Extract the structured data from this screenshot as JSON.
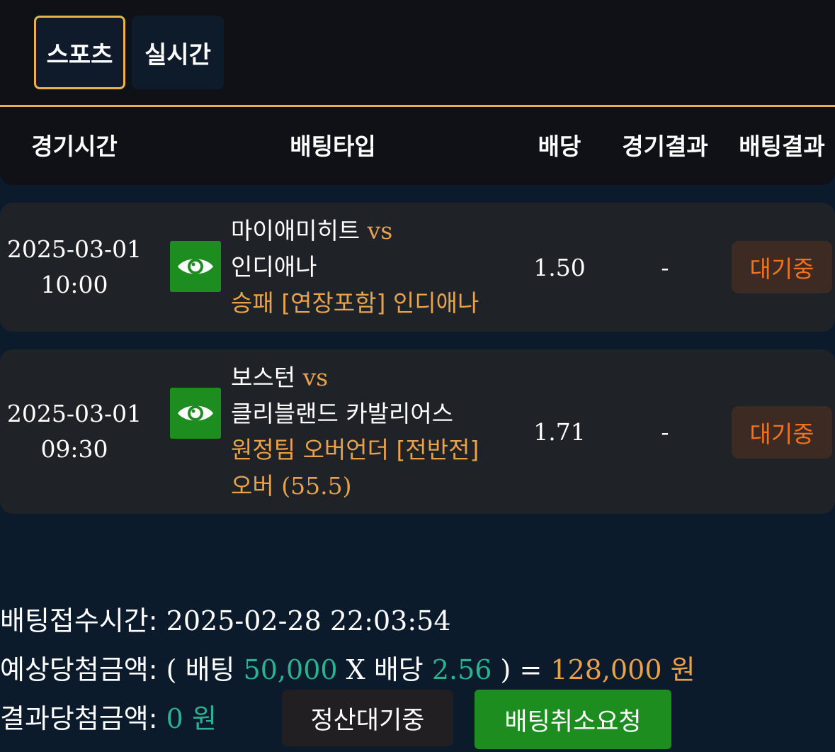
{
  "tabs": [
    {
      "label": "스포츠",
      "active": true
    },
    {
      "label": "실시간",
      "active": false
    }
  ],
  "columns": {
    "time": "경기시간",
    "bet_type": "배팅타입",
    "odds": "배당",
    "game_result": "경기결과",
    "bet_result": "배팅결과"
  },
  "rows": [
    {
      "date": "2025-03-01",
      "time": "10:00",
      "home": "마이애미히트",
      "vs": "vs",
      "away": "인디애나",
      "pick": "승패 [연장포함] 인디애나",
      "pick_line2": "",
      "odds": "1.50",
      "game_result": "-",
      "status": "대기중"
    },
    {
      "date": "2025-03-01",
      "time": "09:30",
      "home": "보스턴",
      "vs": "vs",
      "away": "클리블랜드 카발리어스",
      "pick": "원정팀 오버언더 [전반전]",
      "pick_line2_ko": "오버",
      "pick_line2_num": "(55.5)",
      "odds": "1.71",
      "game_result": "-",
      "status": "대기중"
    }
  ],
  "summary": {
    "received_label": "배팅접수시간:",
    "received_value": "2025-02-28 22:03:54",
    "expected_label": "예상당첨금액:",
    "open_paren": "(",
    "bet_word": "배팅",
    "bet_amount": "50,000",
    "times": "X",
    "odds_word": "배당",
    "total_odds": "2.56",
    "close_eq": ") =",
    "expected_amount": "128,000",
    "won": "원",
    "result_label": "결과당첨금액:",
    "result_amount": "0",
    "result_won": "원"
  },
  "buttons": {
    "settle_label": "정산대기중",
    "cancel_label": "배팅취소요청"
  },
  "colors": {
    "accent_gold": "#e7b34a",
    "pick_orange": "#e8a24c",
    "status_orange": "#f2711f",
    "green_button": "#1e8d20",
    "money_green": "#2ab391"
  },
  "icons": {
    "view": "eye-icon"
  }
}
